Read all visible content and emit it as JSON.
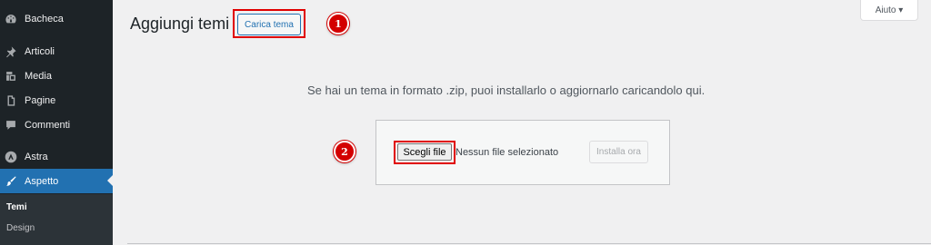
{
  "sidebar": {
    "items": [
      {
        "label": "Bacheca",
        "icon": "dashboard-icon"
      },
      {
        "label": "Articoli",
        "icon": "pin-icon"
      },
      {
        "label": "Media",
        "icon": "media-icon"
      },
      {
        "label": "Pagine",
        "icon": "page-icon"
      },
      {
        "label": "Commenti",
        "icon": "comment-icon"
      },
      {
        "label": "Astra",
        "icon": "astra-icon"
      },
      {
        "label": "Aspetto",
        "icon": "brush-icon"
      }
    ],
    "submenu": [
      "Temi",
      "Design"
    ]
  },
  "header": {
    "title": "Aggiungi temi",
    "upload_button": "Carica tema",
    "help_button": "Aiuto ▾"
  },
  "steps": [
    "1",
    "2"
  ],
  "upload": {
    "instructions": "Se hai un tema in formato .zip, puoi installarlo o aggiornarlo caricandolo qui.",
    "choose_file": "Scegli file",
    "file_status": "Nessun file selezionato",
    "install_button": "Installa ora"
  },
  "colors": {
    "sidebar_bg": "#1d2327",
    "accent": "#2271b1",
    "highlight": "#e00000"
  }
}
